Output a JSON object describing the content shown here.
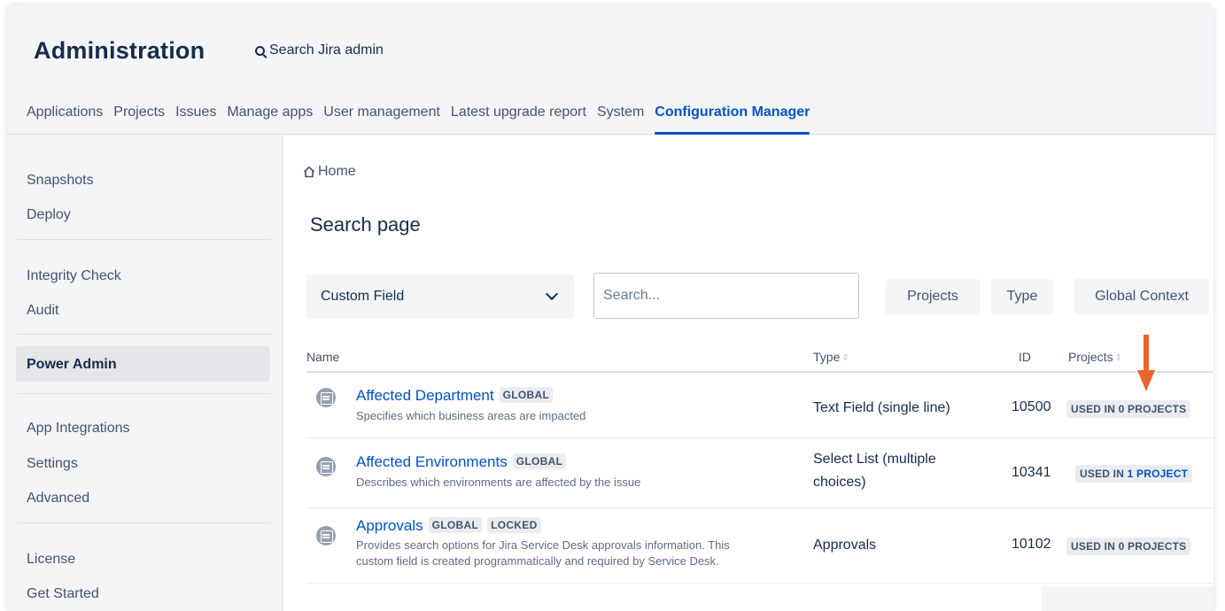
{
  "header": {
    "title": "Administration",
    "search_label": "Search Jira admin"
  },
  "topnav": [
    {
      "label": "Applications"
    },
    {
      "label": "Projects"
    },
    {
      "label": "Issues"
    },
    {
      "label": "Manage apps"
    },
    {
      "label": "User management"
    },
    {
      "label": "Latest upgrade report"
    },
    {
      "label": "System"
    },
    {
      "label": "Configuration Manager"
    }
  ],
  "topnav_active": "Configuration Manager",
  "sidebar": {
    "groups": [
      [
        "Snapshots",
        "Deploy"
      ],
      [
        "Integrity Check",
        "Audit"
      ],
      [
        "Power Admin"
      ],
      [
        "App Integrations",
        "Settings",
        "Advanced"
      ],
      [
        "License",
        "Get Started"
      ]
    ],
    "active": "Power Admin"
  },
  "breadcrumb": {
    "home": "Home"
  },
  "page_title": "Search page",
  "filters": {
    "select_value": "Custom Field",
    "search_placeholder": "Search...",
    "buttons": [
      "Projects",
      "Type",
      "Global Context"
    ]
  },
  "table": {
    "headers": {
      "name": "Name",
      "type": "Type",
      "id": "ID",
      "projects": "Projects"
    },
    "rows": [
      {
        "name": "Affected Department",
        "badges": [
          "GLOBAL"
        ],
        "desc": [
          "Specifies which business areas are impacted"
        ],
        "type": [
          "Text Field (single line)"
        ],
        "id": "10500",
        "projects_prefix": "USED IN ",
        "projects_num": "0",
        "projects_suffix": " PROJECTS",
        "projects_num_highlight": false
      },
      {
        "name": "Affected Environments",
        "badges": [
          "GLOBAL"
        ],
        "desc": [
          "Describes which environments are affected by the issue"
        ],
        "type": [
          "Select List (multiple",
          "choices)"
        ],
        "id": "10341",
        "projects_prefix": "USED IN ",
        "projects_num": "1",
        "projects_suffix": " PROJECT",
        "projects_num_highlight": true
      },
      {
        "name": "Approvals",
        "badges": [
          "GLOBAL",
          "LOCKED"
        ],
        "desc": [
          "Provides search options for Jira Service Desk approvals information. This",
          "custom field is created programmatically and required by Service Desk."
        ],
        "type": [
          "Approvals"
        ],
        "id": "10102",
        "projects_prefix": "USED IN ",
        "projects_num": "0",
        "projects_suffix": " PROJECTS",
        "projects_num_highlight": false
      }
    ]
  },
  "colors": {
    "accent": "#0052cc",
    "arrow": "#e8652b",
    "sidebar_bg": "#f4f5f7",
    "lozenge_bg": "#ebecf0"
  },
  "icons": {
    "search": "search-icon",
    "home": "home-icon",
    "chevron": "chevron-down-icon",
    "field": "custom-field-icon",
    "sort": "sort-icon",
    "annotation": "annotation-arrow-icon"
  }
}
